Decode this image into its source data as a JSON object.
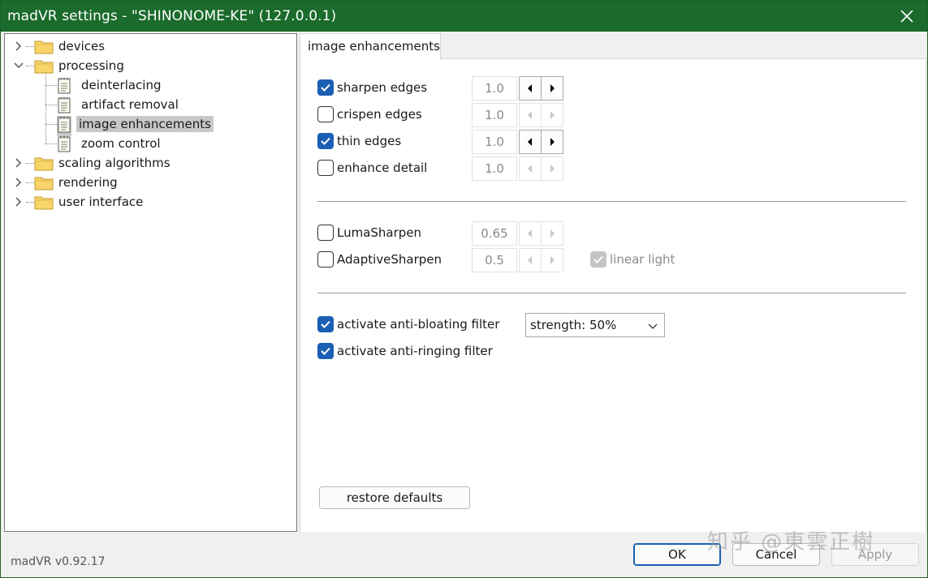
{
  "window": {
    "title": "madVR settings - \"SHINONOME-KE\" (127.0.0.1)",
    "version": "madVR v0.92.17",
    "watermark": "知乎 @東雲正樹"
  },
  "tree": {
    "items": [
      {
        "label": "devices",
        "type": "folder",
        "expanded": false
      },
      {
        "label": "processing",
        "type": "folder",
        "expanded": true
      },
      {
        "label": "deinterlacing",
        "type": "page"
      },
      {
        "label": "artifact removal",
        "type": "page"
      },
      {
        "label": "image enhancements",
        "type": "page",
        "selected": true
      },
      {
        "label": "zoom control",
        "type": "page"
      },
      {
        "label": "scaling algorithms",
        "type": "folder",
        "expanded": false
      },
      {
        "label": "rendering",
        "type": "folder",
        "expanded": false
      },
      {
        "label": "user interface",
        "type": "folder",
        "expanded": false
      }
    ]
  },
  "tab": {
    "label": "image enhancements"
  },
  "options": {
    "sharpen_edges": {
      "label": "sharpen edges",
      "checked": true,
      "value": "1.0"
    },
    "crispen_edges": {
      "label": "crispen edges",
      "checked": false,
      "value": "1.0"
    },
    "thin_edges": {
      "label": "thin edges",
      "checked": true,
      "value": "1.0"
    },
    "enhance_detail": {
      "label": "enhance detail",
      "checked": false,
      "value": "1.0"
    },
    "luma_sharpen": {
      "label": "LumaSharpen",
      "checked": false,
      "value": "0.65"
    },
    "adaptive_sharpen": {
      "label": "AdaptiveSharpen",
      "checked": false,
      "value": "0.5"
    },
    "linear_light": {
      "label": "linear light",
      "checked": true,
      "disabled": true
    },
    "anti_bloating": {
      "label": "activate anti-bloating filter",
      "checked": true
    },
    "anti_ringing": {
      "label": "activate anti-ringing filter",
      "checked": true
    },
    "strength": {
      "selected": "strength: 50%"
    }
  },
  "buttons": {
    "restore_defaults": "restore defaults",
    "ok": "OK",
    "cancel": "Cancel",
    "apply": "Apply"
  },
  "colors": {
    "titlebar": "#1a6b2c",
    "checkbox_checked": "#1a5fb4",
    "selection": "#c8c8c8"
  }
}
